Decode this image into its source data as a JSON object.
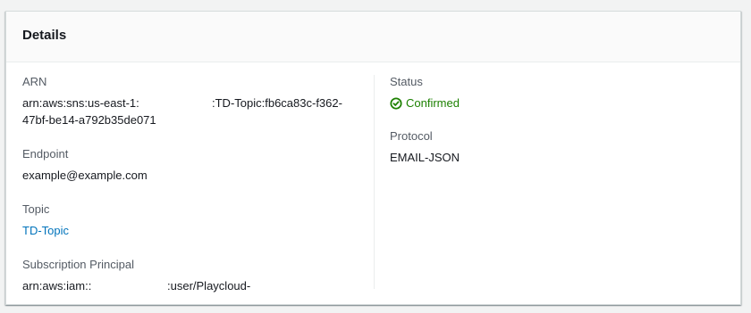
{
  "panel": {
    "title": "Details"
  },
  "left": {
    "arn": {
      "label": "ARN",
      "value_part1": "arn:aws:sns:us-east-1:",
      "value_part2": ":TD-Topic:fb6ca83c-f362-",
      "value_line2": "47bf-be14-a792b35de071"
    },
    "endpoint": {
      "label": "Endpoint",
      "value": "example@example.com"
    },
    "topic": {
      "label": "Topic",
      "value": "TD-Topic"
    },
    "principal": {
      "label": "Subscription Principal",
      "value_part1": "arn:aws:iam::",
      "value_part2": ":user/Playcloud-"
    }
  },
  "right": {
    "status": {
      "label": "Status",
      "value": "Confirmed",
      "icon": "check-circle-icon",
      "color": "#1d8102"
    },
    "protocol": {
      "label": "Protocol",
      "value": "EMAIL-JSON"
    }
  },
  "colors": {
    "link": "#0073bb",
    "label": "#545b64",
    "text": "#16191f"
  }
}
